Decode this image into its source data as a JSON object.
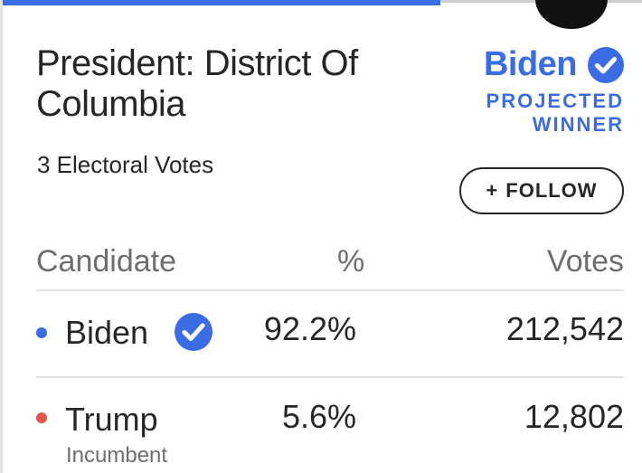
{
  "race": {
    "title": "President: District Of Columbia",
    "electoral_votes": "3 Electoral Votes"
  },
  "winner": {
    "name": "Biden",
    "projected_label_line1": "PROJECTED",
    "projected_label_line2": "WINNER",
    "verified_icon": "check-circle-icon"
  },
  "follow_button": {
    "icon": "plus-icon",
    "label": "FOLLOW"
  },
  "table": {
    "headers": {
      "candidate": "Candidate",
      "percent": "%",
      "votes": "Votes"
    },
    "rows": [
      {
        "name": "Biden",
        "subtitle": "",
        "percent": "92.2%",
        "votes": "212,542",
        "dot_color": "#3a6ce6",
        "winner": true
      },
      {
        "name": "Trump",
        "subtitle": "Incumbent",
        "percent": "5.6%",
        "votes": "12,802",
        "dot_color": "#e8554a",
        "winner": false
      }
    ]
  },
  "colors": {
    "accent": "#3a6ce6",
    "republican": "#e8554a",
    "text": "#262626",
    "muted": "#6e6e6e"
  }
}
